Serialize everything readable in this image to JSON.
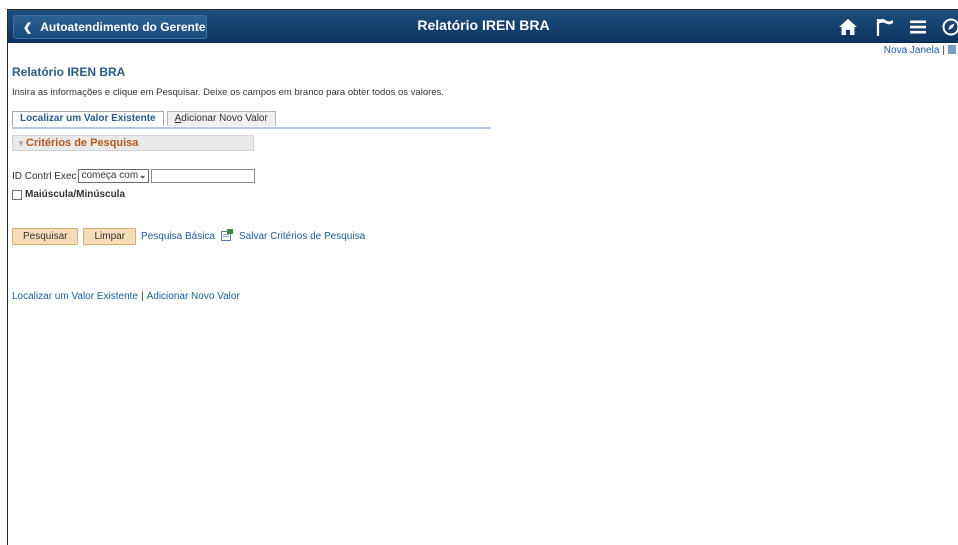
{
  "header": {
    "back_label": "Autoatendimento do Gerente",
    "title": "Relatório IREN BRA",
    "icons": [
      "home-icon",
      "flag-icon",
      "menu-icon",
      "navbar-icon"
    ]
  },
  "top_links": {
    "new_window": "Nova Janela",
    "separator": "|"
  },
  "page": {
    "title": "Relatório IREN BRA",
    "instructions": "Insira as informações e clique em Pesquisar. Deixe os campos em branco para obter todos os valores."
  },
  "tabs": [
    {
      "label": "Localizar um Valor Existente",
      "active": true
    },
    {
      "label_prefix": "A",
      "label_rest": "dicionar Novo Valor",
      "active": false
    }
  ],
  "criteria": {
    "header": "Critérios de Pesquisa",
    "field_label": "ID Contrl Exec",
    "operator_selected": "começa com",
    "field_value": "",
    "case_label": "Maiúscula/Minúscula"
  },
  "actions": {
    "search": "Pesquisar",
    "clear": "Limpar",
    "basic_search": "Pesquisa Básica",
    "save_criteria": "Salvar Critérios de Pesquisa"
  },
  "bottom_links": {
    "find": "Localizar um Valor Existente",
    "separator": "|",
    "add": "Adicionar Novo Valor"
  },
  "colors": {
    "banner": "#0e3560",
    "link": "#1a5c9a",
    "criteria_header": "#b2591d",
    "button": "#f7ddb7"
  }
}
